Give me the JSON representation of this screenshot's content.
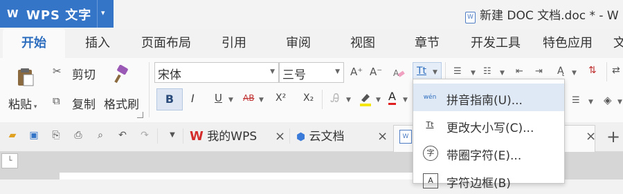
{
  "app": {
    "logo": "W",
    "name": "WPS 文字",
    "menu_arrow": "▾"
  },
  "title_bar": {
    "doc_title": "新建 DOC 文档.doc * - W",
    "doc_icon": "W"
  },
  "tabs": [
    {
      "label": "开始"
    },
    {
      "label": "插入"
    },
    {
      "label": "页面布局"
    },
    {
      "label": "引用"
    },
    {
      "label": "审阅"
    },
    {
      "label": "视图"
    },
    {
      "label": "章节"
    },
    {
      "label": "开发工具"
    },
    {
      "label": "特色应用"
    },
    {
      "label": "文"
    }
  ],
  "ribbon": {
    "paste": "粘贴",
    "cut": "剪切",
    "copy": "复制",
    "format_painter": "格式刷",
    "font_name": "宋体",
    "font_size": "三号",
    "bold": "B",
    "italic": "I",
    "underline": "U",
    "strikethrough": "AB",
    "superscript": "X²",
    "subscript": "X₂",
    "font_color": "A",
    "grow_font": "A⁺",
    "shrink_font": "A⁻",
    "change_case": "Tt"
  },
  "doc_tabs": [
    {
      "label": "我的WPS"
    },
    {
      "label": "云文档"
    }
  ],
  "add_tab": "+",
  "dropdown_menu": {
    "items": [
      {
        "label": "拼音指南(U)...",
        "icon": "wén"
      },
      {
        "label": "更改大小写(C)...",
        "icon": "Tt"
      },
      {
        "label": "带圈字符(E)...",
        "icon": "字"
      },
      {
        "label": "字符边框(B)",
        "icon": "A"
      }
    ]
  },
  "document": {
    "text": ""
  },
  "colors": {
    "accent": "#3575c8",
    "highlight": "#dfe9f6",
    "red_text": "#d03030"
  }
}
